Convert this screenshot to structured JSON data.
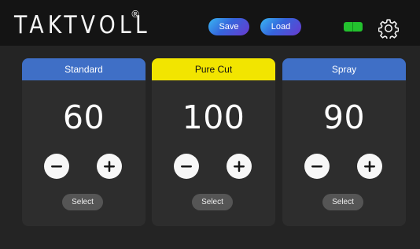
{
  "header": {
    "logo": "TAKTVOLL",
    "logo_registered": "®",
    "save_label": "Save",
    "load_label": "Load",
    "status_icon": "status-indicator-icon",
    "settings_icon": "gear-icon"
  },
  "panels": [
    {
      "title": "Standard",
      "value": "60",
      "minus_icon": "minus-icon",
      "plus_icon": "plus-icon",
      "select_label": "Select",
      "header_color": "#3f6fc6",
      "header_text_color": "#ffffff"
    },
    {
      "title": "Pure Cut",
      "value": "100",
      "minus_icon": "minus-icon",
      "plus_icon": "plus-icon",
      "select_label": "Select",
      "header_color": "#f2e500",
      "header_text_color": "#111111"
    },
    {
      "title": "Spray",
      "value": "90",
      "minus_icon": "minus-icon",
      "plus_icon": "plus-icon",
      "select_label": "Select",
      "header_color": "#3f6fc6",
      "header_text_color": "#ffffff"
    }
  ],
  "colors": {
    "background": "#242424",
    "header_background": "#141414",
    "panel_background": "#2d2d2d",
    "button_background": "#f7f7f7",
    "select_background": "#555555",
    "status_green": "#23c12e"
  }
}
